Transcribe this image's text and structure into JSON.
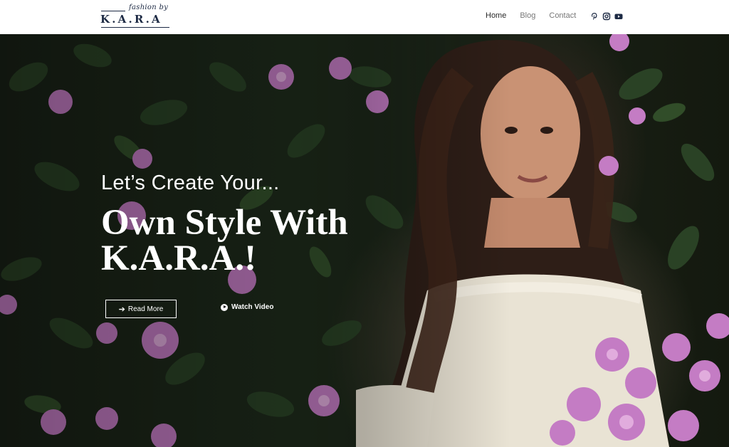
{
  "brand": {
    "script": "fashion by",
    "name": "K.A.R.A"
  },
  "nav": {
    "items": [
      {
        "label": "Home",
        "active": true
      },
      {
        "label": "Blog",
        "active": false
      },
      {
        "label": "Contact",
        "active": false
      }
    ]
  },
  "social": {
    "icons": [
      "pinterest-icon",
      "instagram-icon",
      "youtube-icon"
    ]
  },
  "hero": {
    "kicker": "Let’s Create Your...",
    "headline": "Own Style With K.A.R.A.!",
    "read_more_label": "Read More",
    "watch_video_label": "Watch Video"
  },
  "colors": {
    "brand": "#1d2a44",
    "nav_active": "#2b2b2b",
    "nav": "#777777",
    "hero_text": "#ffffff",
    "flower": "#c47cc4"
  }
}
